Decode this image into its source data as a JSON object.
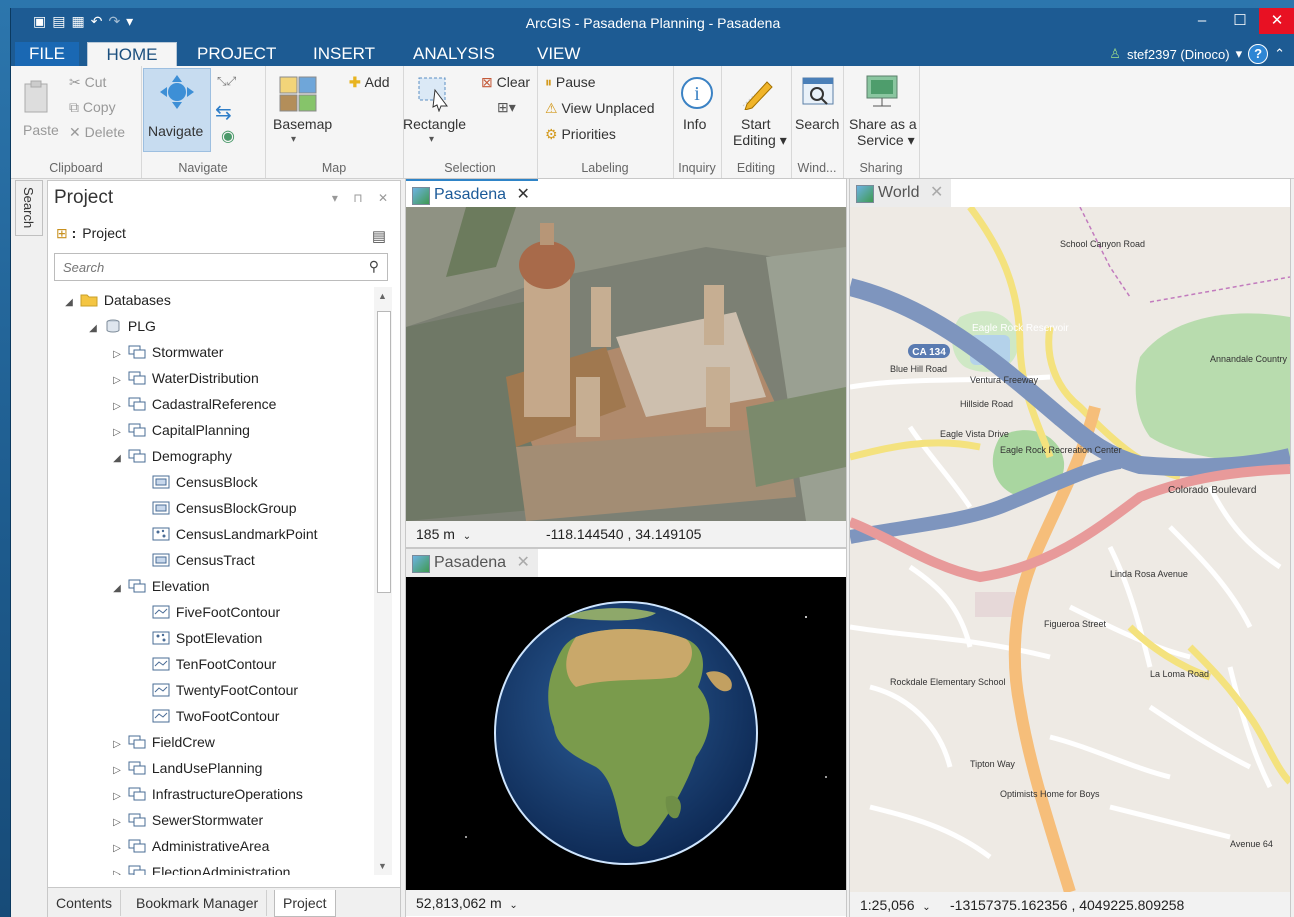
{
  "window": {
    "title": "ArcGIS - Pasadena Planning - Pasadena"
  },
  "tabs": [
    "FILE",
    "HOME",
    "PROJECT",
    "INSERT",
    "ANALYSIS",
    "VIEW"
  ],
  "user": {
    "name": "stef2397 (Dinoco)",
    "help": "?"
  },
  "ribbon": {
    "clipboard": {
      "label": "Clipboard",
      "paste": "Paste",
      "cut": "Cut",
      "copy": "Copy",
      "delete": "Delete"
    },
    "navigate": {
      "label": "Navigate",
      "navigate": "Navigate"
    },
    "map": {
      "label": "Map",
      "basemap": "Basemap",
      "add": "Add"
    },
    "selection": {
      "label": "Selection",
      "rectangle": "Rectangle",
      "clear": "Clear"
    },
    "labeling": {
      "label": "Labeling",
      "pause": "Pause",
      "view_unplaced": "View Unplaced",
      "priorities": "Priorities"
    },
    "inquiry": {
      "label": "Inquiry",
      "info": "Info"
    },
    "editing": {
      "label": "Editing",
      "start": "Start",
      "editing": "Editing"
    },
    "windows": {
      "label": "Wind...",
      "search": "Search"
    },
    "sharing": {
      "label": "Sharing",
      "share": "Share as a",
      "service": "Service"
    }
  },
  "sidebar_tab": "Search",
  "project_panel": {
    "title": "Project",
    "root": "Project",
    "search_placeholder": "Search",
    "tree": [
      {
        "label": "Databases",
        "level": 0,
        "state": "open",
        "icon": "folder"
      },
      {
        "label": "PLG",
        "level": 1,
        "state": "open",
        "icon": "database"
      },
      {
        "label": "Stormwater",
        "level": 2,
        "state": "closed",
        "icon": "dataset"
      },
      {
        "label": "WaterDistribution",
        "level": 2,
        "state": "closed",
        "icon": "dataset"
      },
      {
        "label": "CadastralReference",
        "level": 2,
        "state": "closed",
        "icon": "dataset"
      },
      {
        "label": "CapitalPlanning",
        "level": 2,
        "state": "closed",
        "icon": "dataset"
      },
      {
        "label": "Demography",
        "level": 2,
        "state": "open",
        "icon": "dataset"
      },
      {
        "label": "CensusBlock",
        "level": 3,
        "state": "none",
        "icon": "polygon"
      },
      {
        "label": "CensusBlockGroup",
        "level": 3,
        "state": "none",
        "icon": "polygon"
      },
      {
        "label": "CensusLandmarkPoint",
        "level": 3,
        "state": "none",
        "icon": "point"
      },
      {
        "label": "CensusTract",
        "level": 3,
        "state": "none",
        "icon": "polygon"
      },
      {
        "label": "Elevation",
        "level": 2,
        "state": "open",
        "icon": "dataset"
      },
      {
        "label": "FiveFootContour",
        "level": 3,
        "state": "none",
        "icon": "line"
      },
      {
        "label": "SpotElevation",
        "level": 3,
        "state": "none",
        "icon": "point"
      },
      {
        "label": "TenFootContour",
        "level": 3,
        "state": "none",
        "icon": "line"
      },
      {
        "label": "TwentyFootContour",
        "level": 3,
        "state": "none",
        "icon": "line"
      },
      {
        "label": "TwoFootContour",
        "level": 3,
        "state": "none",
        "icon": "line"
      },
      {
        "label": "FieldCrew",
        "level": 2,
        "state": "closed",
        "icon": "dataset"
      },
      {
        "label": "LandUsePlanning",
        "level": 2,
        "state": "closed",
        "icon": "dataset"
      },
      {
        "label": "InfrastructureOperations",
        "level": 2,
        "state": "closed",
        "icon": "dataset"
      },
      {
        "label": "SewerStormwater",
        "level": 2,
        "state": "closed",
        "icon": "dataset"
      },
      {
        "label": "AdministrativeArea",
        "level": 2,
        "state": "closed",
        "icon": "dataset"
      },
      {
        "label": "ElectionAdministration",
        "level": 2,
        "state": "closed",
        "icon": "dataset"
      }
    ],
    "bottom_tabs": [
      "Contents",
      "Bookmark Manager",
      "Project"
    ]
  },
  "maps": {
    "scene": {
      "tab": "Pasadena",
      "scale": "185 m",
      "coords": "-118.144540 , 34.149105"
    },
    "globe": {
      "tab": "Pasadena",
      "scale": "52,813,062 m"
    },
    "world": {
      "tab": "World",
      "scale": "1:25,056",
      "coords": "-13157375.162356 , 4049225.809258",
      "labels": {
        "ca134": "CA 134",
        "eagle_rock_reservoir": "Eagle Rock Reservoir",
        "eagle_rock_rec": "Eagle Rock Recreation Center",
        "annandale": "Annandale Country Club",
        "colorado_blvd": "Colorado Boulevard",
        "ventura_fwy": "Ventura Freeway",
        "figueroa": "Figueroa Street",
        "rockdale": "Rockdale Elementary School",
        "optimists": "Optimists Home for Boys",
        "linda_rosa": "Linda Rosa Avenue",
        "tipton": "Tipton Way",
        "la_loma": "La Loma Road",
        "blue_hill": "Blue Hill Road",
        "school_canyon": "School Canyon Road",
        "eagle_vista": "Eagle Vista Drive",
        "hillside": "Hillside Road",
        "avenue64": "Avenue 64"
      }
    }
  }
}
